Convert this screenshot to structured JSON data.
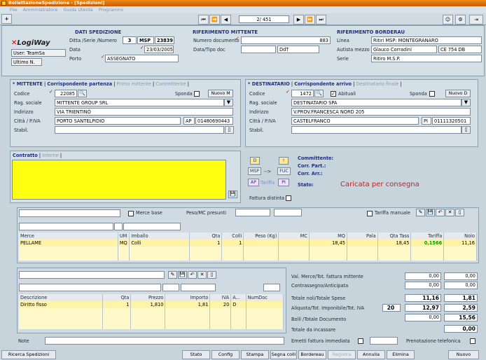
{
  "window": {
    "title": "BollettazioneSpedizione - [Spedizioni]"
  },
  "menu": {
    "items": [
      "File",
      "Amministratore",
      "Guida Utente",
      "Programmi"
    ]
  },
  "nav": {
    "record": "2/ 451"
  },
  "dati": {
    "header": "DATI SPEDIZIONE",
    "ditta_label": "Ditta /Serie /Numero",
    "ditta": "3",
    "serie": "MSP",
    "numero": "23839",
    "data_label": "Data",
    "data": "23/03/2005",
    "porto_label": "Porto",
    "porto": "ASSEGNATO",
    "user": "User: TeamSa",
    "ultimo": "Ultimo N.",
    "logo": "LogiWay"
  },
  "rif_mittente": {
    "header": "RIFERIMENTO MITTENTE",
    "numdoc_label": "Numero documento",
    "numdoc": "883",
    "datatipo_label": "Data/Tipo doc",
    "tipo": "DdT"
  },
  "rif_bordereau": {
    "header": "RIFERIMENTO BORDERAU",
    "linea_label": "Linea",
    "linea": "Ritiri MSP: MONTEGRANARO",
    "autista_label": "Autista mezzo",
    "autista": "Glauco Corradini",
    "targa": "CE 754 DB",
    "serie_label": "Serie",
    "serie": "Ritiro M.S.P."
  },
  "mittente": {
    "tabs": [
      "* MITTENTE",
      "Corrispondente partenza",
      "Primo mittente",
      "Committente"
    ],
    "codice_label": "Codice",
    "codice": "22085",
    "sponda_label": "Sponda",
    "nuovo_label": "Nuovo M",
    "ragsoc_label": "Rag. sociale",
    "ragsoc": "MITTENTE GROUP SRL",
    "indirizzo_label": "Indirizzo",
    "indirizzo": "VIA TRIENTINO",
    "citta_label": "Città / P.IVA",
    "citta": "PORTO SANTELPIDIO",
    "prov": "AP",
    "piva": "01480690443",
    "stabil_label": "Stabil."
  },
  "destinatario": {
    "tabs": [
      "* DESTINATARIO",
      "Corrispondente arrivo",
      "Destinatario finale"
    ],
    "codice_label": "Codice",
    "codice": "1472",
    "abituali_label": "Abituali",
    "sponda_label": "Sponda",
    "nuovo_label": "Nuovo D",
    "ragsoc_label": "Rag. sociale",
    "ragsoc": "DESTINATARIO SPA",
    "indirizzo_label": "Indirizzo",
    "indirizzo": "V.PROV.FRANCESCA NORD 205",
    "citta_label": "Città / P.IVA",
    "citta": "CASTELFRANCO",
    "prov": "PI",
    "piva": "01111320501",
    "stabil_label": "Stabil."
  },
  "contratto": {
    "tabs": [
      "Contratto",
      "Interne"
    ],
    "btn_d": "D",
    "btn_i": "!",
    "msp": "MSP",
    "arrow": "-->",
    "fuc": "FUC",
    "ap": "AP",
    "tariffa": "Tariffa",
    "pi": "PI",
    "fattura_distinta": "Fattura distinta",
    "committente_label": "Committente:",
    "corr_part_label": "Corr. Part.:",
    "corr_arr_label": "Corr. Arr.:",
    "stato_label": "Stato:",
    "stato": "Caricata per consegna"
  },
  "merce": {
    "merce_base": "Merce base",
    "peso_presunti": "Peso/MC presunti",
    "tariffa_manuale": "Tariffa manuale",
    "columns": [
      "Merce",
      "UM",
      "Imballo",
      "Qta",
      "Colli",
      "Peso (Kg)",
      "MC",
      "MQ",
      "Pala",
      "Qta Tass",
      "Tariffa",
      "Nolo"
    ],
    "row": {
      "merce": "PELLAME",
      "um": "MQ",
      "imballo": "Colli",
      "qta": "1",
      "colli": "1",
      "peso": "",
      "mc": "",
      "mq": "18,45",
      "pala": "",
      "qtatass": "18,45",
      "tariffa": "0,1566",
      "nolo": "11,16"
    }
  },
  "spese": {
    "columns": [
      "Descrizione",
      "Qta",
      "Prezzo",
      "Importo",
      "IVA",
      "A...",
      "NumDoc"
    ],
    "row": {
      "desc": "Diritto fisso",
      "qta": "1",
      "prezzo": "1,810",
      "importo": "1,81",
      "iva": "20",
      "a": "D",
      "numdoc": ""
    }
  },
  "totali": {
    "val_merce_label": "Val. Merce/Tot. fattura mittente",
    "val_merce": "0,00",
    "val_merce2": "0,00",
    "contrassegno_label": "Contrassegno/Anticipata",
    "contrassegno": "0,00",
    "contrassegno2": "0,00",
    "totnoli_label": "Totale noli/Totale Spese",
    "totnoli": "11,16",
    "totspese": "1,81",
    "aliquota_label": "Aliquota/Tot. Imponibile/Tot. IVA",
    "aliquota": "20",
    "imponibile": "12,97",
    "iva": "2,59",
    "bolli_label": "Bolli /Totale Documento",
    "bolli": "0,00",
    "totdoc": "15,56",
    "incassare_label": "Totale da incassare",
    "incassare": "0,00",
    "emetti_label": "Emetti fattura immediata",
    "prenotazione_label": "Prenotazione telefonica"
  },
  "note": {
    "label": "Note"
  },
  "bottom": {
    "ricerca": "Ricerca Spedizioni",
    "buttons": [
      "Stato",
      "Config",
      "Stampa",
      "Segna colli",
      "Bordereau",
      "Registra",
      "Annulla",
      "Elimina",
      "Nuovo"
    ]
  }
}
